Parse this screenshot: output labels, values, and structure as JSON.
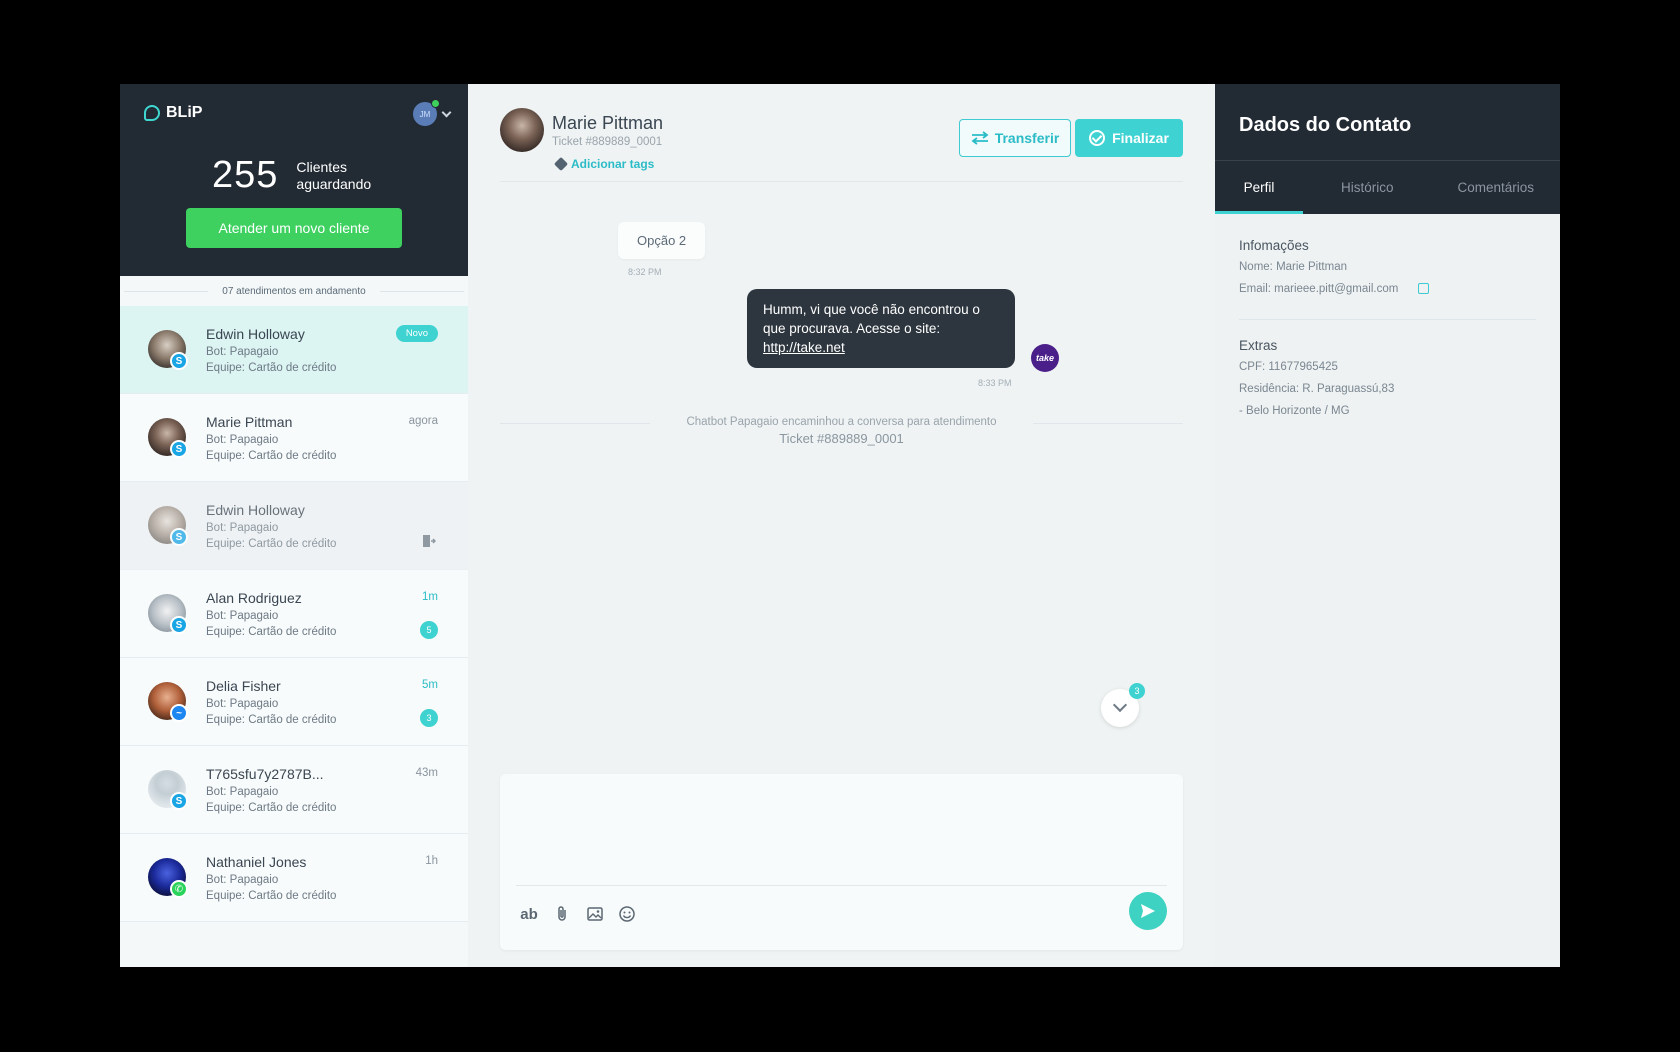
{
  "brand": {
    "name": "BLiP"
  },
  "user": {
    "initials": "JM"
  },
  "queue": {
    "count": "255",
    "label": "Clientes aguardando",
    "new_button": "Atender um novo cliente"
  },
  "list_header": "07 atendimentos em andamento",
  "conversations": [
    {
      "name": "Edwin Holloway",
      "bot": "Bot: Papagaio",
      "team": "Equipe: Cartão de crédito",
      "tag": "Novo"
    },
    {
      "name": "Marie Pittman",
      "bot": "Bot: Papagaio",
      "team": "Equipe: Cartão de crédito",
      "time": "agora"
    },
    {
      "name": "Edwin Holloway",
      "bot": "Bot: Papagaio",
      "team": "Equipe: Cartão de crédito"
    },
    {
      "name": "Alan Rodriguez",
      "bot": "Bot: Papagaio",
      "team": "Equipe: Cartão de crédito",
      "time": "1m",
      "count": "5"
    },
    {
      "name": "Delia Fisher",
      "bot": "Bot: Papagaio",
      "team": "Equipe: Cartão de crédito",
      "time": "5m",
      "count": "3"
    },
    {
      "name": "T765sfu7y2787B...",
      "bot": "Bot: Papagaio",
      "team": "Equipe: Cartão de crédito",
      "time": "43m"
    },
    {
      "name": "Nathaniel Jones",
      "bot": "Bot: Papagaio",
      "team": "Equipe: Cartão de crédito",
      "time": "1h"
    }
  ],
  "chat": {
    "name": "Marie Pittman",
    "ticket": "Ticket #889889_0001",
    "add_tags": "Adicionar tags",
    "transfer": "Transferir",
    "finish": "Finalizar",
    "msg_in": "Opção 2",
    "msg_in_time": "8:32 PM",
    "msg_out": "Humm, vi que você não encontrou o que procurava. Acesse o site:",
    "msg_out_link": "http://take.net",
    "msg_out_time": "8:33 PM",
    "bot_label": "take",
    "system_text": "Chatbot Papagaio encaminhou a conversa para atendimento",
    "system_ticket": "Ticket #889889_0001",
    "unread": "3",
    "tool_ab": "ab"
  },
  "contact": {
    "title": "Dados do Contato",
    "tabs": [
      "Perfil",
      "Histórico",
      "Comentários"
    ],
    "info_title": "Infomações",
    "name_line": "Nome: Marie Pittman",
    "email_line": "Email: marieee.pitt@gmail.com",
    "extras_title": "Extras",
    "cpf": "CPF: 11677965425",
    "res1": "Residência: R. Paraguassú,83",
    "res2": "- Belo Horizonte / MG"
  },
  "colors": {
    "accent": "#3ed2d2",
    "green": "#3ed160",
    "dark": "#222a33"
  }
}
